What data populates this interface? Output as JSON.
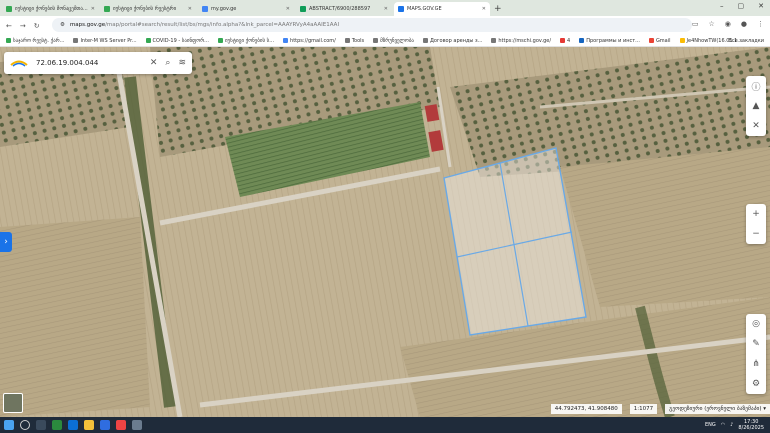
{
  "browser": {
    "tabs": [
      {
        "label": "იუსტიცი ქონების მონაცემთა...",
        "active": false,
        "color": "#34a853"
      },
      {
        "label": "იუსტიცი ქონების რეესტრი",
        "active": false,
        "color": "#34a853"
      },
      {
        "label": "my.gov.ge",
        "active": false,
        "color": "#4285f4"
      },
      {
        "label": "ABSTRACT/6900/288597",
        "active": false,
        "color": "#0f9d58"
      },
      {
        "label": "MAPS.GOV.GE",
        "active": true,
        "color": "#1a73e8"
      }
    ],
    "new_tab": "+",
    "window_controls": [
      "–",
      "▢",
      "✕"
    ],
    "url_host": "maps.gov.ge",
    "url_path": "/map/portal#search/result/list/bs/mgs/info.alpha?&lnk_parcel=AAAYRVyA4aAAIE1AAI",
    "bookmarks": [
      {
        "label": "საჯარო რეესტ. ქარ...",
        "color": "#34a853"
      },
      {
        "label": "Inter-M WS Server Pr...",
        "color": "#777"
      },
      {
        "label": "COVID-19 - საინფორ...",
        "color": "#34a853"
      },
      {
        "label": "იუსტიცი ქონების ს...",
        "color": "#34a853"
      },
      {
        "label": "https://gmail.com/",
        "color": "#4285f4"
      },
      {
        "label": "Tools",
        "color": "#777"
      },
      {
        "label": "მზრუნველობა",
        "color": "#777"
      },
      {
        "label": "Договор аренды з...",
        "color": "#777"
      },
      {
        "label": "https://mschi.gov.ge/",
        "color": "#777"
      },
      {
        "label": "4",
        "color": "#e53935"
      },
      {
        "label": "Программы и инст...",
        "color": "#1565c0"
      },
      {
        "label": "Gmail",
        "color": "#ea4335"
      },
      {
        "label": "Je4NhowTW(16.01.1...",
        "color": "#fbbc04"
      }
    ],
    "all_bookmarks": "Все закладки"
  },
  "map": {
    "search_value": "72.06.19.004.044",
    "coordinates": "44.792473, 41.908480",
    "scale": "1:1077",
    "layer_select": "გეოდეზიური (ეროვნული ბაზემაპი)",
    "parcel_color": "#6aa9e6"
  },
  "system": {
    "time": "17:30",
    "date": "8/26/2025",
    "lang": "ENG"
  }
}
